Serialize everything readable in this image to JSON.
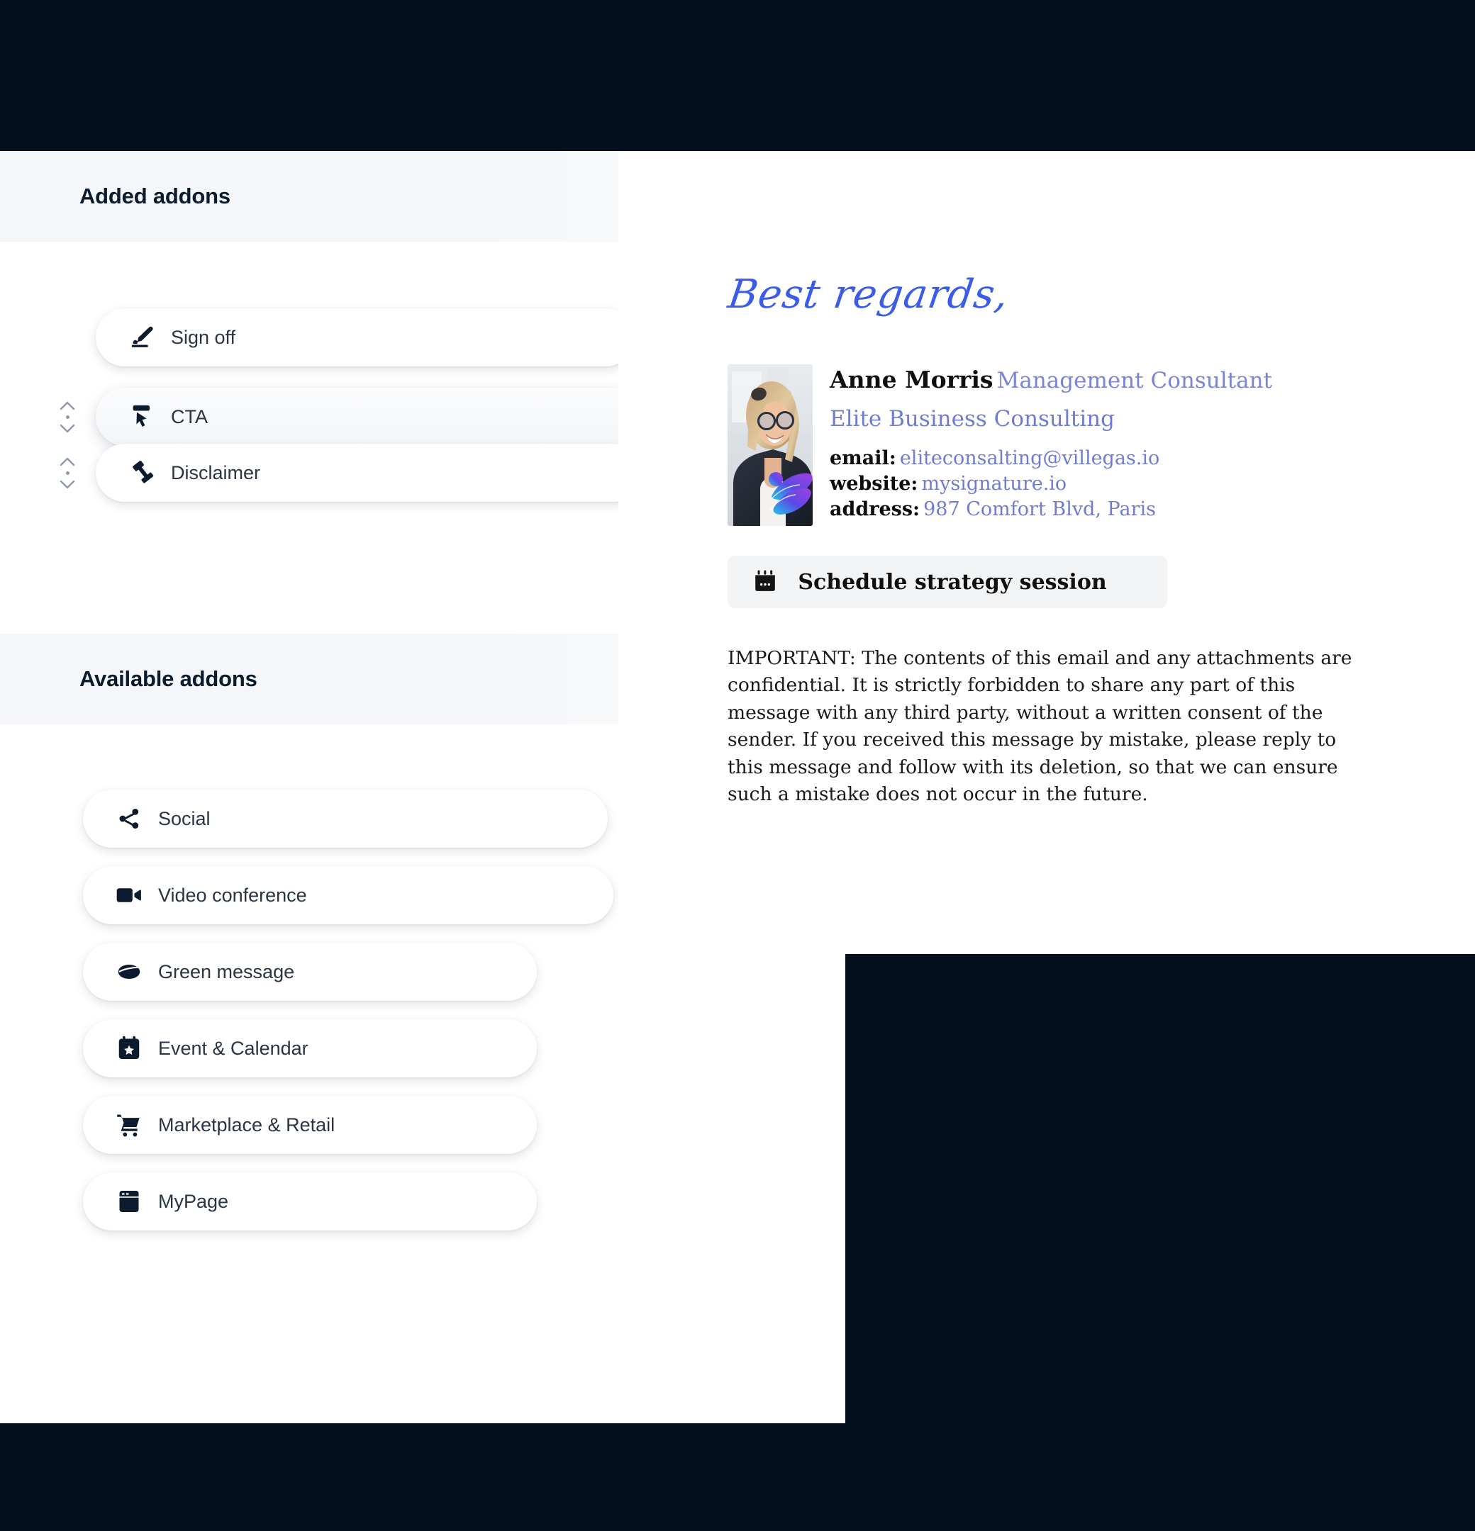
{
  "panels": {
    "left": {
      "background": "#ffffff"
    },
    "right": {
      "background": "#ffffff"
    },
    "page_background": "#030f1d"
  },
  "addons_panel": {
    "added_section": {
      "title": "Added addons",
      "items": [
        {
          "label": "Sign off",
          "icon": "signature-pen-icon",
          "draggable": false,
          "raised": false
        },
        {
          "label": "CTA",
          "icon": "cursor-click-icon",
          "draggable": true,
          "raised": true
        },
        {
          "label": "Disclaimer",
          "icon": "gavel-icon",
          "draggable": true,
          "raised": false
        }
      ]
    },
    "available_section": {
      "title": "Available addons",
      "items": [
        {
          "label": "Social",
          "icon": "share-icon"
        },
        {
          "label": "Video conference",
          "icon": "video-camera-icon"
        },
        {
          "label": "Green message",
          "icon": "leaf-icon"
        },
        {
          "label": "Event & Calendar",
          "icon": "calendar-star-icon"
        },
        {
          "label": "Marketplace & Retail",
          "icon": "shopping-cart-icon"
        },
        {
          "label": "MyPage",
          "icon": "browser-window-icon"
        }
      ]
    }
  },
  "signature_preview": {
    "closing": "Best regards,",
    "closing_color": "#3b5ce8",
    "avatar": {
      "alt": "Anne Morris portrait",
      "logo": "butterfly-logo"
    },
    "name": "Anne Morris",
    "job_title": "Management Consultant",
    "company": "Elite Business Consulting",
    "accent_color": "#6f7ccf",
    "fields": [
      {
        "key": "email:",
        "value": "eliteconsalting@villegas.io"
      },
      {
        "key": "website:",
        "value": "mysignature.io"
      },
      {
        "key": "address:",
        "value": "987 Comfort Blvd, Paris"
      }
    ],
    "cta": {
      "label": "Schedule strategy session",
      "icon": "calendar-icon",
      "background": "#f2f3f4"
    },
    "disclaimer": "IMPORTANT: The contents of this email and any attachments are confidential. It is strictly forbidden to share any part of this message with any third party, without a written consent of the sender. If you received this message by mistake, please reply to this message and follow with its deletion, so that we can ensure such a mistake does not occur in the future."
  }
}
